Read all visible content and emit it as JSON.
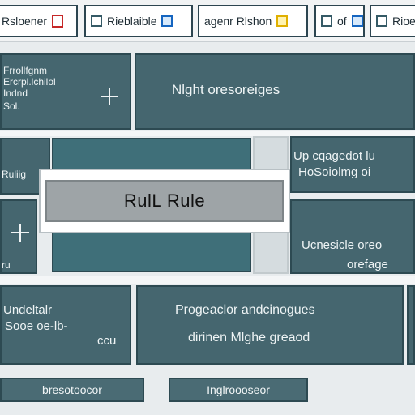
{
  "tabs": [
    {
      "label": "Rsloener",
      "icon": "file-icon-red"
    },
    {
      "label": "Rieblaible",
      "icon": "window-icon"
    },
    {
      "label": "agenr Rlshon",
      "icon": "note-icon-yellow"
    },
    {
      "label": "of",
      "icon": "window-icon-blue"
    },
    {
      "label": "Rioe",
      "icon": "window-icon"
    }
  ],
  "panels": {
    "top_left": {
      "line1": "Frrollfgnm",
      "line2": "Ercrpl.lchilol",
      "line3": "Indnd",
      "line4": "Sol."
    },
    "top_right": {
      "text": "Nlght oresoreiges"
    },
    "mid_left_top": {
      "text": "Ruliig"
    },
    "mid_right_top": {
      "line1": "Up cqagedot lu",
      "line2": "HoSoiolmg oi"
    },
    "mid_left_bottom": {
      "text": "ru"
    },
    "mid_right_bottom": {
      "line1": "Ucnesicle oreo",
      "line2": "orefage"
    },
    "bottom_left": {
      "line1": "Undeltalr",
      "line2": "Sooe  oe-lb-",
      "line3": "ccu"
    },
    "bottom_center": {
      "line1": "Progeaclor andcinogues",
      "line2": "dirinen Mlghe greaod"
    }
  },
  "rule_box": {
    "label": "RulL Rule"
  },
  "buttons": {
    "left": "bresotoocor",
    "right": "Inglroooseor"
  },
  "colors": {
    "panel": "#45666f",
    "panel_border": "#2d4a52",
    "background": "#e8ecee",
    "accent_red": "#c62828",
    "accent_blue": "#1565c0",
    "accent_yellow": "#e0b000"
  }
}
